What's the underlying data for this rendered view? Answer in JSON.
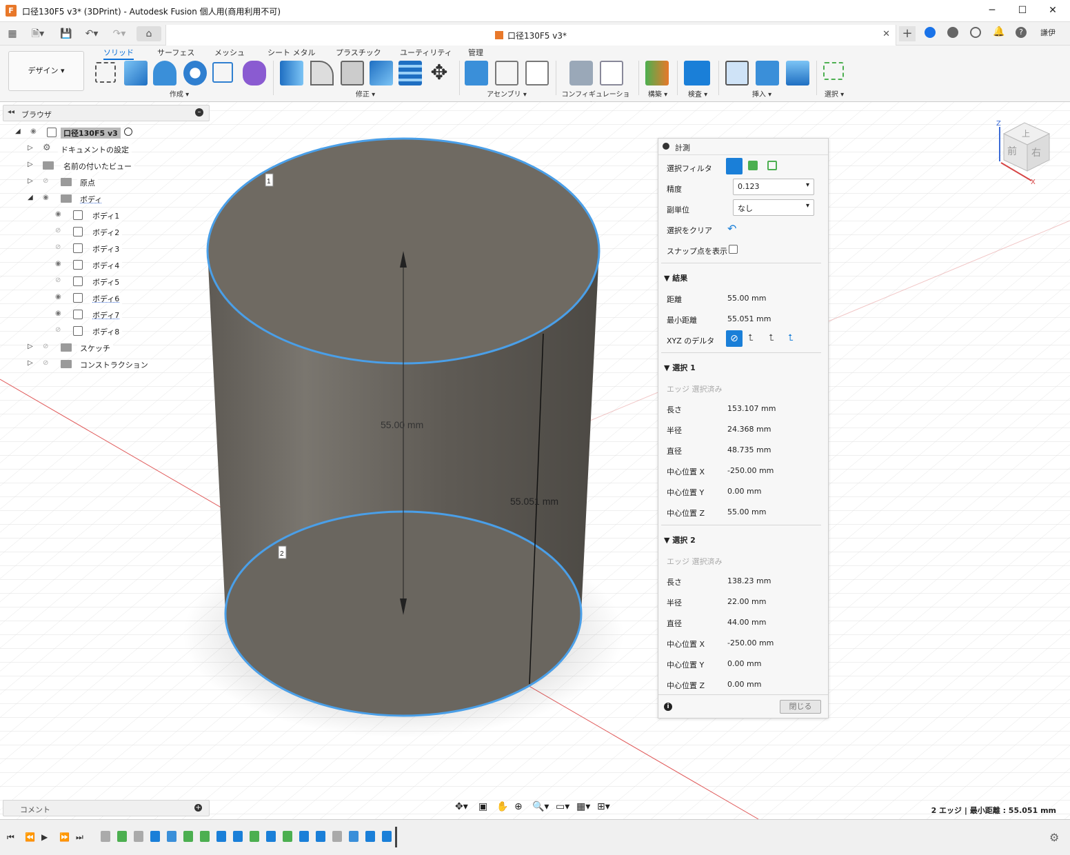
{
  "window": {
    "title": "口径130F5 v3* (3DPrint) - Autodesk Fusion 個人用(商用利用不可)",
    "app_icon": "F",
    "controls": [
      "minimize-icon",
      "maximize-icon",
      "close-icon"
    ]
  },
  "quick_access": {
    "doc_tab_title": "口径130F5 v3*",
    "user": "謙伊"
  },
  "ribbon": {
    "workspace": "デザイン ▾",
    "tabs": [
      "ソリッド",
      "サーフェス",
      "メッシュ",
      "シート メタル",
      "プラスチック",
      "ユーティリティ",
      "管理"
    ],
    "active_tab": "ソリッド",
    "groups": [
      "作成 ▾",
      "修正 ▾",
      "アセンブリ ▾",
      "コンフィギュレーション ▾",
      "構築 ▾",
      "検査 ▾",
      "挿入 ▾",
      "選択 ▾"
    ]
  },
  "browser": {
    "title": "ブラウザ",
    "root": "口径130F5 v3",
    "items": [
      {
        "label": "ドキュメントの設定"
      },
      {
        "label": "名前の付いたビュー"
      },
      {
        "label": "原点"
      },
      {
        "label": "ボディ"
      },
      {
        "label": "ボディ1"
      },
      {
        "label": "ボディ2"
      },
      {
        "label": "ボディ3"
      },
      {
        "label": "ボディ4"
      },
      {
        "label": "ボディ5"
      },
      {
        "label": "ボディ6"
      },
      {
        "label": "ボディ7"
      },
      {
        "label": "ボディ8"
      },
      {
        "label": "スケッチ"
      },
      {
        "label": "コンストラクション"
      }
    ]
  },
  "viewport": {
    "dim_label": "55.00 mm",
    "min_label": "55.051 mm",
    "marker1": "1",
    "marker2": "2",
    "viewcube": {
      "top": "上",
      "front": "前",
      "right": "右",
      "z": "Z",
      "x": "X"
    }
  },
  "measure": {
    "title": "計測",
    "select_filter": "選択フィルタ",
    "precision_label": "精度",
    "precision_value": "0.123",
    "sub_unit_label": "副単位",
    "sub_unit_value": "なし",
    "clear_label": "選択をクリア",
    "snap_label": "スナップ点を表示",
    "results": {
      "title": "結果",
      "distance_label": "距離",
      "distance": "55.00 mm",
      "min_label": "最小距離",
      "min": "55.051 mm",
      "xyz_label": "XYZ のデルタ"
    },
    "sel1": {
      "title": "選択 1",
      "note": "エッジ 選択済み",
      "rows": [
        {
          "k": "長さ",
          "v": "153.107 mm"
        },
        {
          "k": "半径",
          "v": "24.368 mm"
        },
        {
          "k": "直径",
          "v": "48.735 mm"
        },
        {
          "k": "中心位置 X",
          "v": "-250.00 mm"
        },
        {
          "k": "中心位置 Y",
          "v": "0.00 mm"
        },
        {
          "k": "中心位置 Z",
          "v": "55.00 mm"
        }
      ]
    },
    "sel2": {
      "title": "選択 2",
      "note": "エッジ 選択済み",
      "rows": [
        {
          "k": "長さ",
          "v": "138.23 mm"
        },
        {
          "k": "半径",
          "v": "22.00 mm"
        },
        {
          "k": "直径",
          "v": "44.00 mm"
        },
        {
          "k": "中心位置 X",
          "v": "-250.00 mm"
        },
        {
          "k": "中心位置 Y",
          "v": "0.00 mm"
        },
        {
          "k": "中心位置 Z",
          "v": "0.00 mm"
        }
      ]
    },
    "close": "閉じる"
  },
  "comment": {
    "title": "コメント"
  },
  "status": "2 エッジ | 最小距離 : 55.051 mm",
  "colors": {
    "accent": "#0a6fd8",
    "highlight": "#4a9fe8",
    "body": "#6f6a62"
  }
}
